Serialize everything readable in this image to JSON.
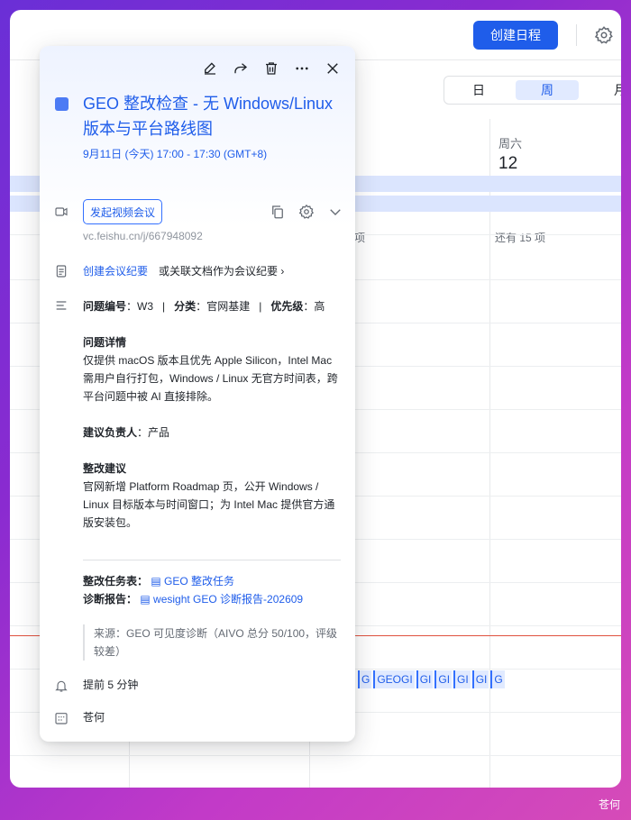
{
  "toolbar": {
    "create_label": "创建日程",
    "view_day": "日",
    "view_week": "周",
    "view_month": "月"
  },
  "calendar": {
    "day_label": "周六",
    "day_number": "12",
    "more_left": "项",
    "more_right": "还有 15 项",
    "chips": [
      "G",
      "GEOGI",
      "GI",
      "GI",
      "GI",
      "GI",
      "G"
    ]
  },
  "event": {
    "title": "GEO 整改检查 - 无 Windows/Linux 版本与平台路线图",
    "time": "9月11日 (今天) 17:00 - 17:30 (GMT+8)",
    "color": "#4c7bf4",
    "video_button": "发起视频会议",
    "video_link": "vc.feishu.cn/j/667948092",
    "minutes_create": "创建会议纪要",
    "minutes_link": "或关联文档作为会议纪要 ›",
    "meta": {
      "id_key": "问题编号",
      "id_val": "W3",
      "cat_key": "分类",
      "cat_val": "官网基建",
      "pri_key": "优先级",
      "pri_val": "高"
    },
    "detail_title": "问题详情",
    "detail_text": "仅提供 macOS 版本且优先 Apple Silicon，Intel Mac 需用户自行打包，Windows / Linux 无官方时间表，跨平台问题中被 AI 直接排除。",
    "owner_key": "建议负责人",
    "owner_val": "产品",
    "suggest_title": "整改建议",
    "suggest_text": "官网新增 Platform Roadmap 页，公开 Windows / Linux 目标版本与时间窗口；为 Intel Mac 提供官方通版安装包。",
    "task_key": "整改任务表：",
    "task_val": "GEO 整改任务",
    "report_key": "诊断报告：",
    "report_val": "wesight GEO 诊断报告-202609",
    "source": "来源：GEO 可见度诊断（AIVO 总分 50/100，评级较差）",
    "reminder": "提前 5 分钟",
    "organizer": "苍何"
  },
  "watermark": "苍何"
}
